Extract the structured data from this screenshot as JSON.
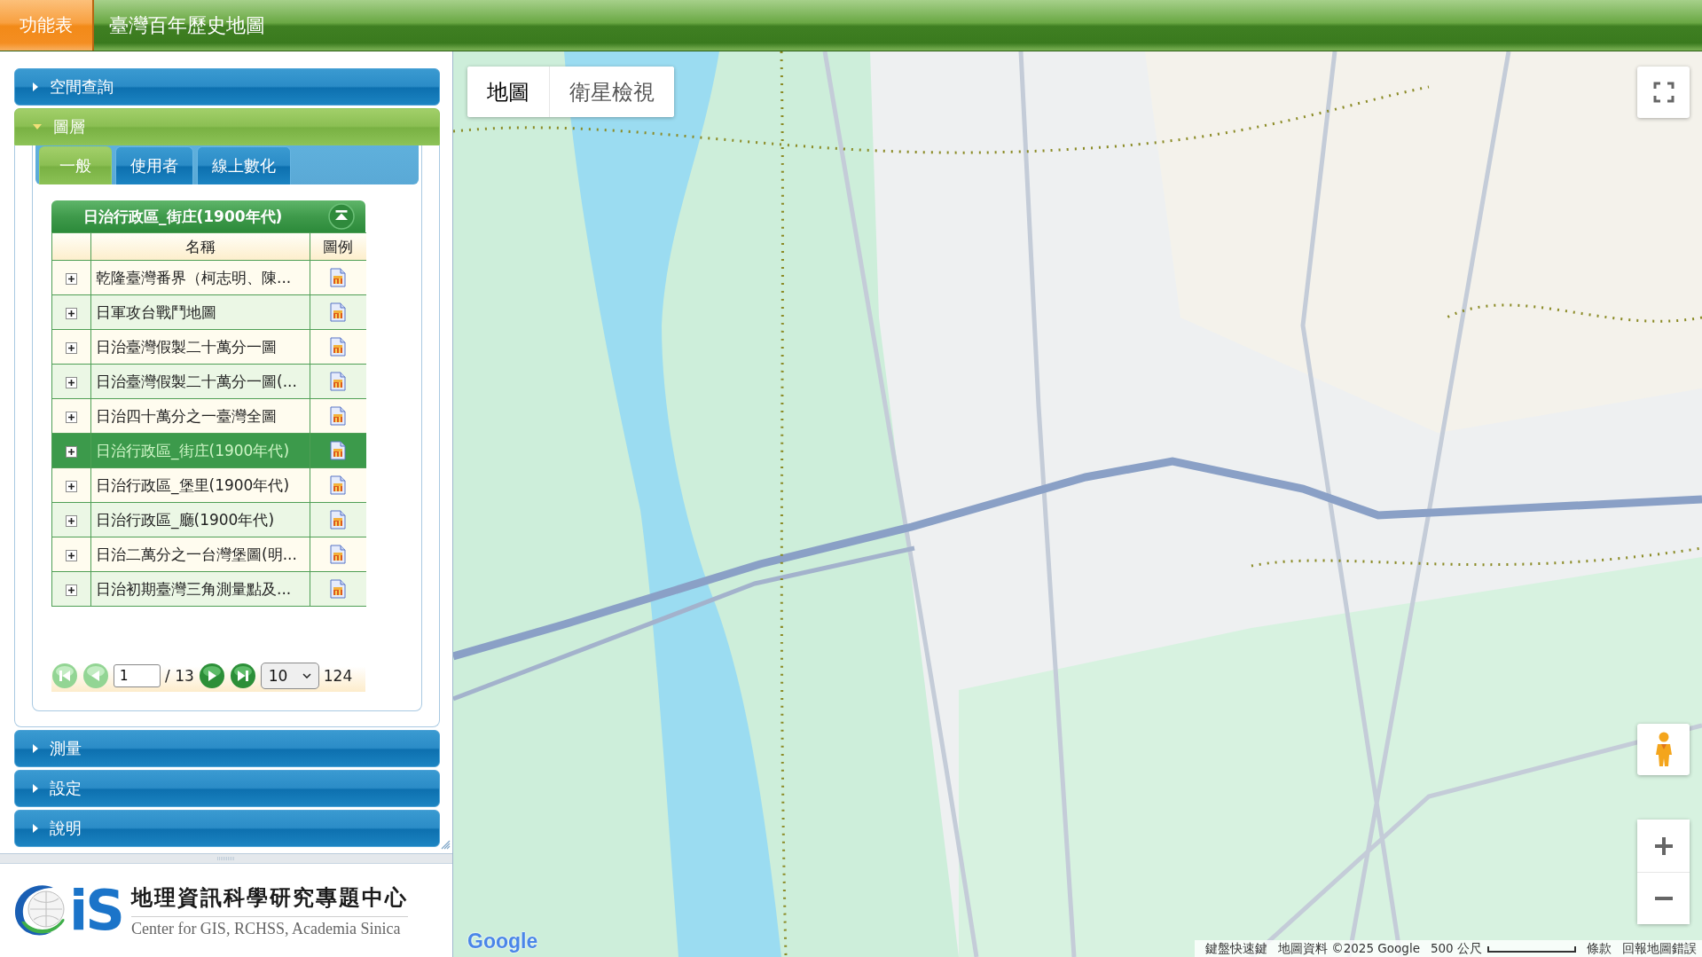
{
  "header": {
    "menu_button": "功能表",
    "title": "臺灣百年歷史地圖"
  },
  "sidebar": {
    "sections": [
      {
        "label": "空間查詢",
        "expanded": false
      },
      {
        "label": "圖層",
        "expanded": true,
        "tabs": [
          {
            "label": "一般",
            "selected": true
          },
          {
            "label": "使用者",
            "selected": false
          },
          {
            "label": "線上數化",
            "selected": false
          }
        ],
        "layer_table": {
          "title": "日治行政區_街庄(1900年代)",
          "columns": [
            "名稱",
            "圖例"
          ],
          "rows": [
            {
              "name": "乾隆臺灣番界（柯志明、陳...",
              "selected": false
            },
            {
              "name": "日軍攻台戰鬥地圖",
              "selected": false
            },
            {
              "name": "日治臺灣假製二十萬分一圖",
              "selected": false
            },
            {
              "name": "日治臺灣假製二十萬分一圖(...",
              "selected": false
            },
            {
              "name": "日治四十萬分之一臺灣全圖",
              "selected": false
            },
            {
              "name": "日治行政區_街庄(1900年代)",
              "selected": true
            },
            {
              "name": "日治行政區_堡里(1900年代)",
              "selected": false
            },
            {
              "name": "日治行政區_廳(1900年代)",
              "selected": false
            },
            {
              "name": "日治二萬分之一台灣堡圖(明...",
              "selected": false
            },
            {
              "name": "日治初期臺灣三角測量點及...",
              "selected": false
            }
          ],
          "pagination": {
            "buttons": [
              {
                "kind": "first",
                "disabled": true
              },
              {
                "kind": "previous",
                "disabled": true
              },
              {
                "kind": "next",
                "disabled": false
              },
              {
                "kind": "last",
                "disabled": false
              }
            ],
            "page": "1",
            "page_total": "/ 13",
            "page_size": "10",
            "record_count": "124"
          }
        }
      },
      {
        "label": "測量",
        "expanded": false
      },
      {
        "label": "設定",
        "expanded": false
      },
      {
        "label": "說明",
        "expanded": false
      }
    ]
  },
  "logo": {
    "mark": "iS",
    "title": "地理資訊科學研究專題中心",
    "subtitle": "Center for GIS, RCHSS, Academia Sinica"
  },
  "map": {
    "type_tabs": [
      {
        "label": "地圖",
        "selected": true
      },
      {
        "label": "衛星檢視",
        "selected": false
      }
    ],
    "google_logo": "Google",
    "footer": {
      "shortcuts": "鍵盤快速鍵",
      "attribution": "地圖資料 ©2025 Google",
      "scale": "500 公尺",
      "terms": "條款",
      "report": "回報地圖錯誤"
    }
  }
}
